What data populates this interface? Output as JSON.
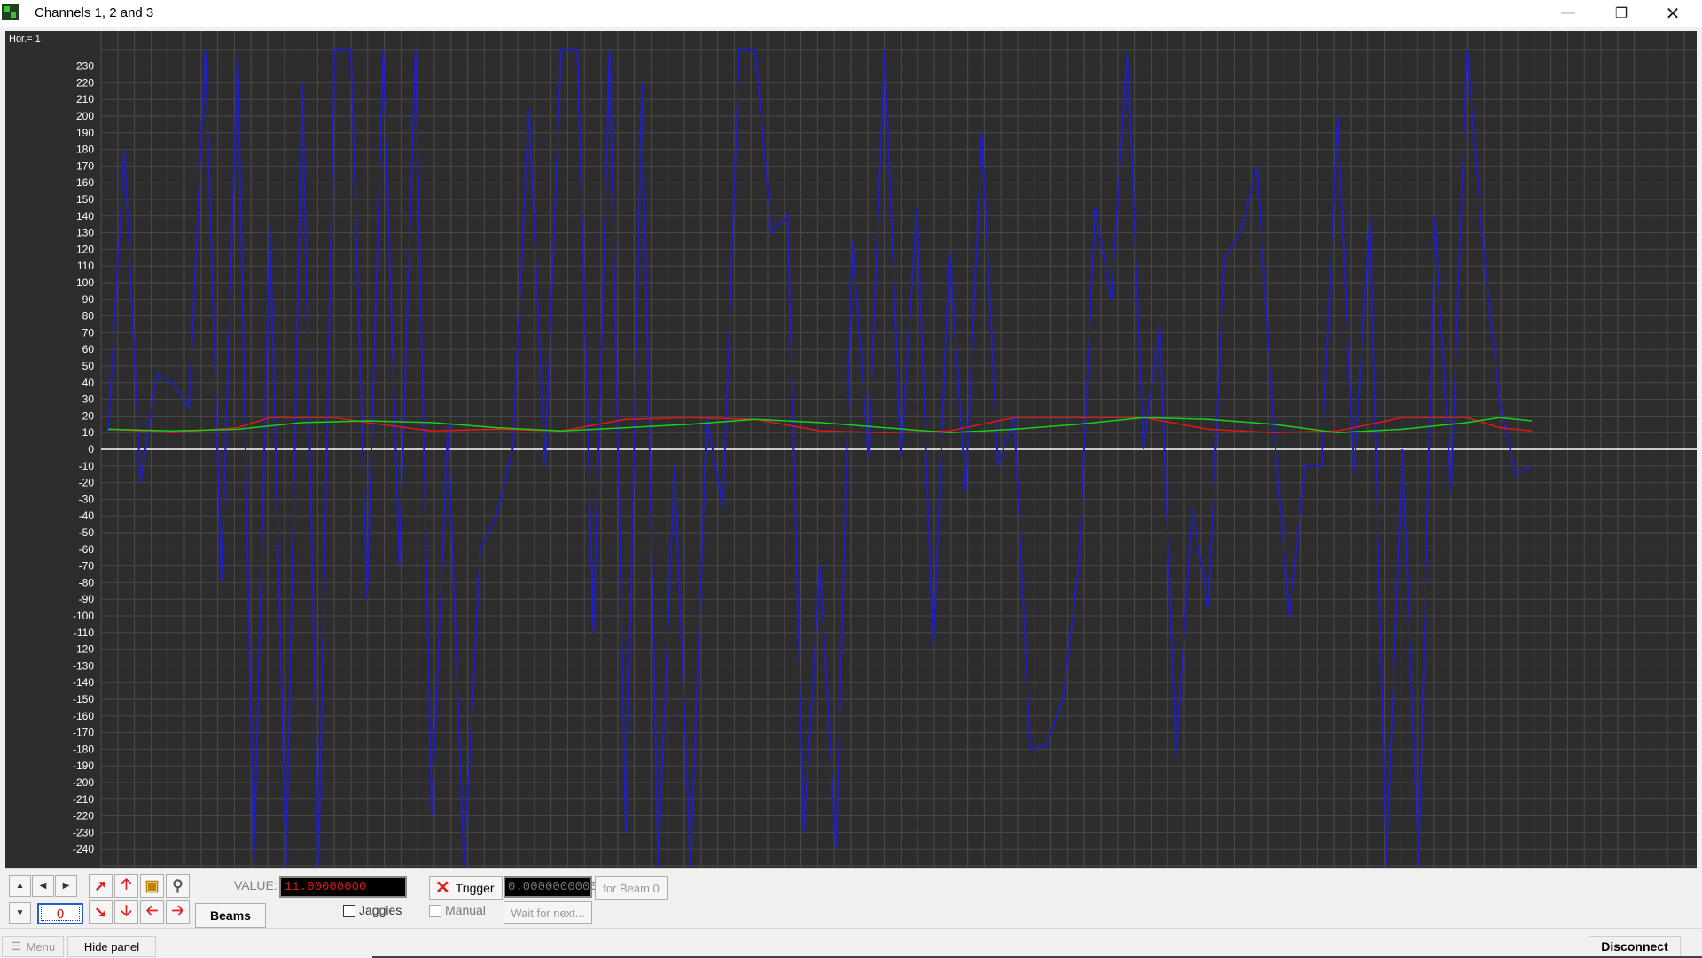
{
  "window": {
    "title": "Channels 1, 2 and 3",
    "min_icon": "minimize-icon",
    "max_icon": "restore-icon",
    "close_icon": "close-icon"
  },
  "scope": {
    "hor_label": "Hor.=  1",
    "background_color": "#2d2d2d",
    "grid_color": "#4a4a4a",
    "zero_line_color": "#ffffff"
  },
  "chart_data": {
    "type": "line",
    "ylim": [
      -250,
      240
    ],
    "xlim": [
      0,
      88
    ],
    "grid": true,
    "yticks": [
      230,
      220,
      210,
      200,
      190,
      180,
      170,
      160,
      150,
      140,
      130,
      120,
      110,
      100,
      90,
      80,
      70,
      60,
      50,
      40,
      30,
      20,
      10,
      0,
      -10,
      -20,
      -30,
      -40,
      -50,
      -60,
      -70,
      -80,
      -90,
      -100,
      -110,
      -120,
      -130,
      -140,
      -150,
      -160,
      -170,
      -180,
      -190,
      -200,
      -210,
      -220,
      -230,
      -240
    ],
    "series": [
      {
        "color": "#2020c0",
        "x": [
          0,
          1,
          2,
          3,
          4,
          5,
          6,
          7,
          8,
          9,
          10,
          11,
          12,
          13,
          14,
          15,
          16,
          17,
          18,
          19,
          20,
          21,
          22,
          23,
          24,
          25,
          26,
          27,
          28,
          29,
          30,
          31,
          32,
          33,
          34,
          35,
          36,
          37,
          38,
          39,
          40,
          41,
          42,
          43,
          44,
          45,
          46,
          47,
          48,
          49,
          50,
          51,
          52,
          53,
          54,
          55,
          56,
          57,
          58,
          59,
          60,
          61,
          62,
          63,
          64,
          65,
          66,
          67,
          68,
          69,
          70,
          71,
          72,
          73,
          74,
          75,
          76,
          77,
          78,
          79,
          80,
          81,
          82,
          83,
          84,
          85,
          86,
          87,
          88
        ],
        "y": [
          10,
          180,
          -20,
          45,
          40,
          25,
          240,
          -80,
          240,
          -250,
          135,
          -250,
          220,
          -250,
          240,
          240,
          -90,
          240,
          -70,
          240,
          -220,
          15,
          -250,
          -60,
          -40,
          0,
          205,
          -10,
          240,
          240,
          -110,
          240,
          -230,
          220,
          -250,
          -10,
          -250,
          20,
          -35,
          240,
          240,
          130,
          140,
          -230,
          -70,
          -240,
          125,
          -5,
          240,
          -5,
          145,
          -120,
          120,
          -25,
          190,
          -10,
          20,
          -180,
          -178,
          -150,
          -70,
          145,
          90,
          240,
          0,
          75,
          -185,
          -35,
          -95,
          115,
          130,
          170,
          20,
          -100,
          -10,
          -10,
          200,
          -15,
          140,
          -250,
          0,
          -250,
          140,
          -25,
          240,
          120,
          30,
          -15,
          -10
        ]
      },
      {
        "color": "#e01818",
        "x": [
          0,
          4,
          8,
          10,
          12,
          14,
          16,
          20,
          24,
          28,
          32,
          36,
          40,
          44,
          48,
          52,
          56,
          60,
          64,
          68,
          72,
          76,
          80,
          84,
          86,
          88
        ],
        "y": [
          12,
          10,
          13,
          19,
          19,
          19,
          16,
          11,
          12,
          11,
          18,
          19,
          18,
          11,
          10,
          11,
          19,
          19,
          19,
          12,
          10,
          11,
          19,
          19,
          13,
          11
        ]
      },
      {
        "color": "#18d018",
        "x": [
          0,
          4,
          8,
          12,
          16,
          20,
          24,
          28,
          32,
          36,
          40,
          44,
          48,
          52,
          56,
          60,
          64,
          68,
          72,
          76,
          80,
          84,
          86,
          88
        ],
        "y": [
          12,
          11,
          12,
          16,
          17,
          16,
          13,
          11,
          13,
          15,
          18,
          16,
          13,
          10,
          12,
          15,
          19,
          18,
          15,
          10,
          12,
          16,
          19,
          17
        ]
      }
    ]
  },
  "panel": {
    "value_label": "VALUE:",
    "value_field": "11.00000000",
    "spin_value": "0",
    "beams_label": "Beams",
    "trigger_label": "Trigger",
    "trigger_value": "0.0000000000",
    "for_beam_label": "for Beam 0",
    "jaggies_label": "Jaggies",
    "manual_label": "Manual",
    "wait_label": "Wait for next..."
  },
  "bottom": {
    "menu_label": "Menu",
    "hide_panel_label": "Hide panel",
    "disconnect_label": "Disconnect"
  }
}
